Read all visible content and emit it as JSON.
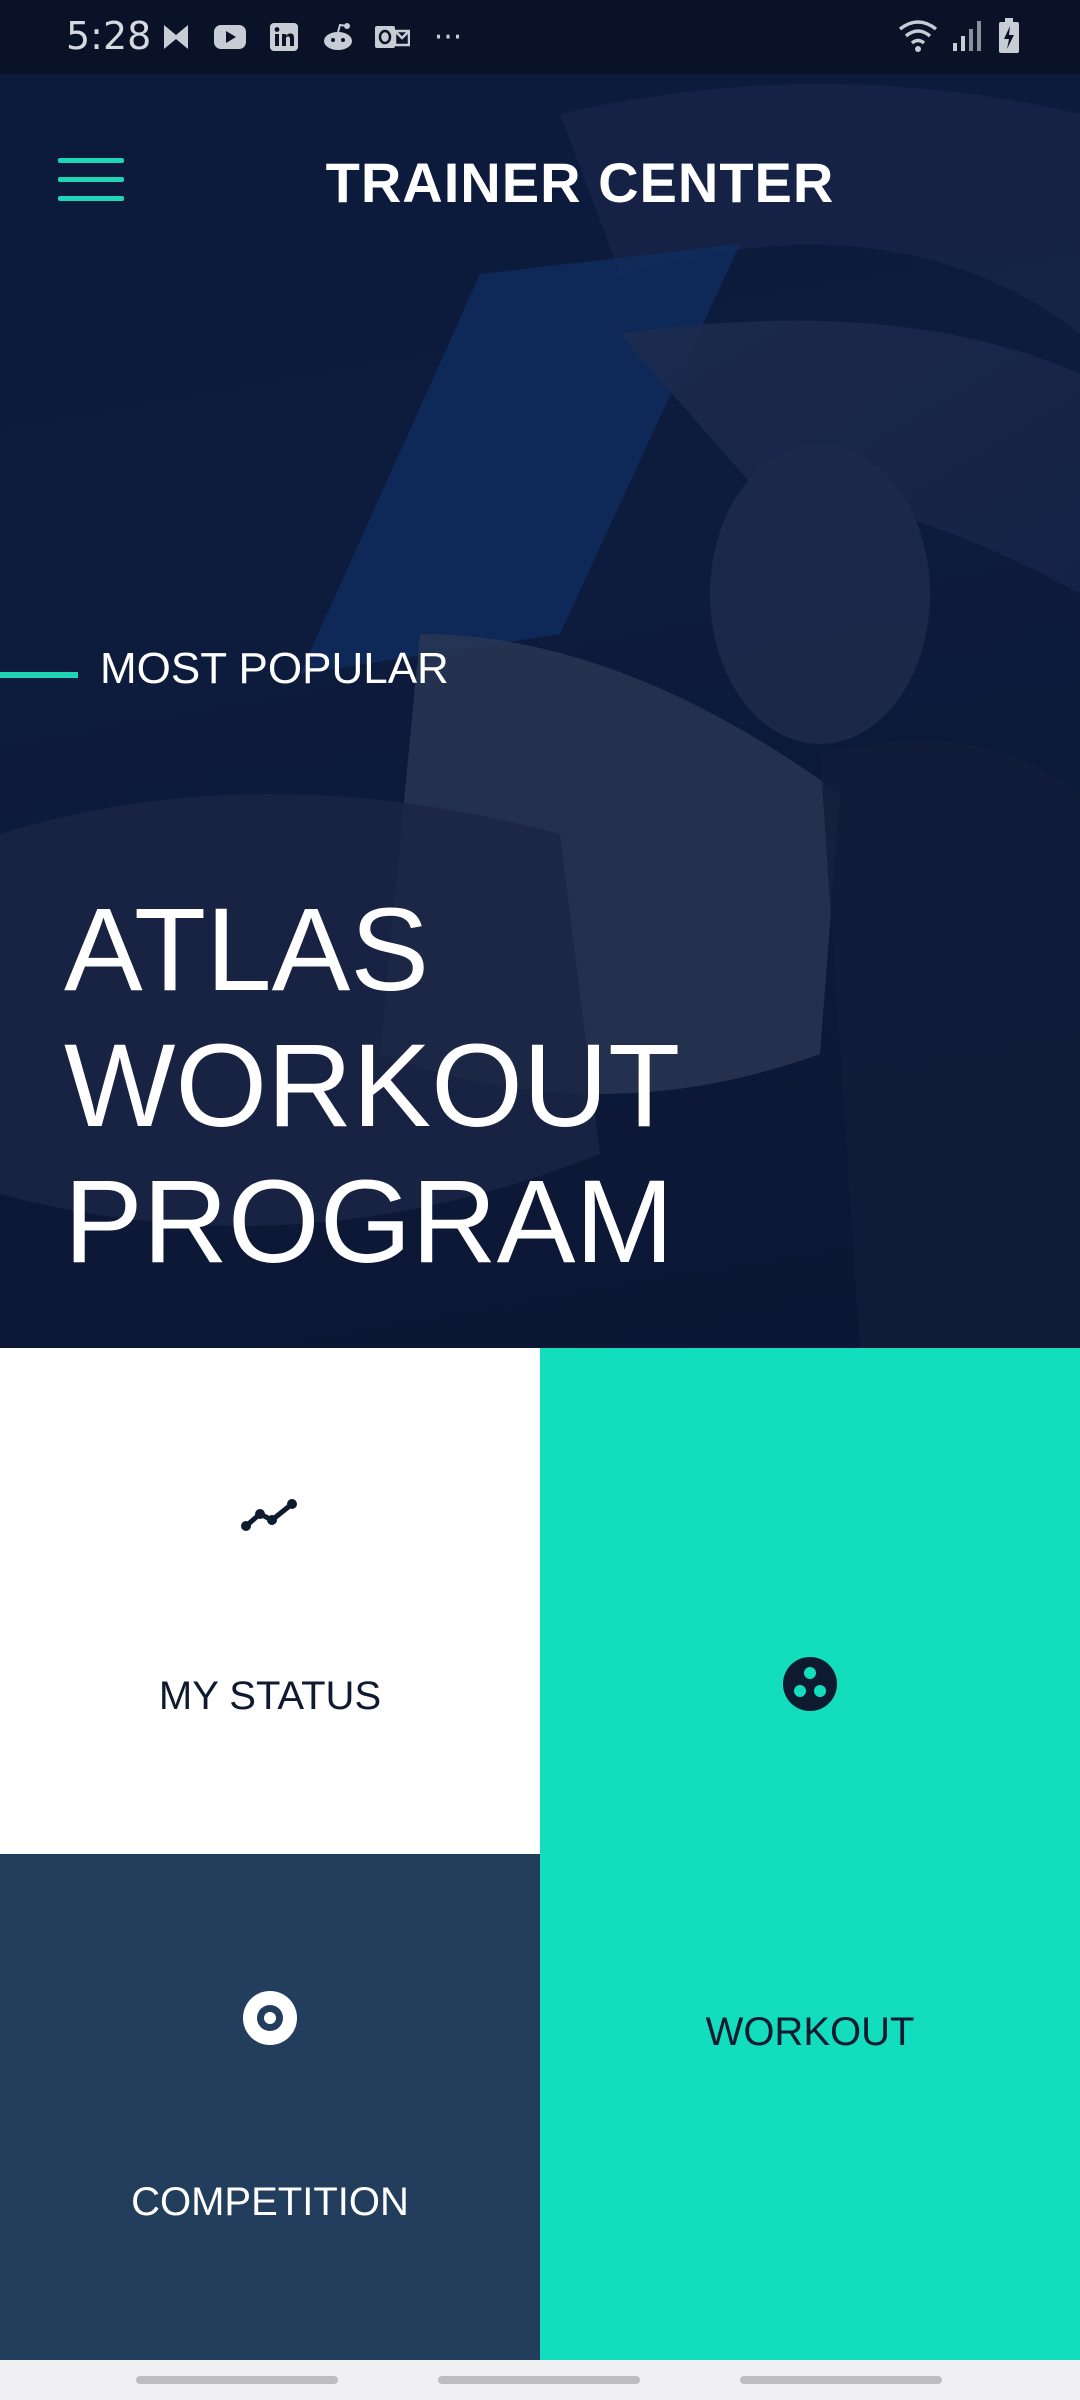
{
  "status_bar": {
    "time": "5:28",
    "overflow": "···",
    "notification_icons": [
      "messenger-icon",
      "youtube-icon",
      "linkedin-icon",
      "reddit-icon",
      "outlook-icon"
    ],
    "system_icons": [
      "wifi-icon",
      "signal-icon",
      "battery-charging-icon"
    ]
  },
  "header": {
    "title": "TRAINER CENTER",
    "menu_icon": "hamburger-menu-icon"
  },
  "hero": {
    "tag": "MOST POPULAR",
    "title_lines": [
      "ATLAS",
      "WORKOUT",
      "PROGRAM"
    ]
  },
  "tiles": {
    "my_status": {
      "label": "MY STATUS",
      "icon": "trend-line-icon"
    },
    "workout": {
      "label": "WORKOUT",
      "icon": "three-dots-circle-icon"
    },
    "competition": {
      "label": "COMPETITION",
      "icon": "target-ring-icon"
    }
  },
  "colors": {
    "accent": "#1ed6b6",
    "workout_tile": "#12ddbd",
    "competition_tile": "#233e5c",
    "hero_background": "#0c1a3c"
  }
}
